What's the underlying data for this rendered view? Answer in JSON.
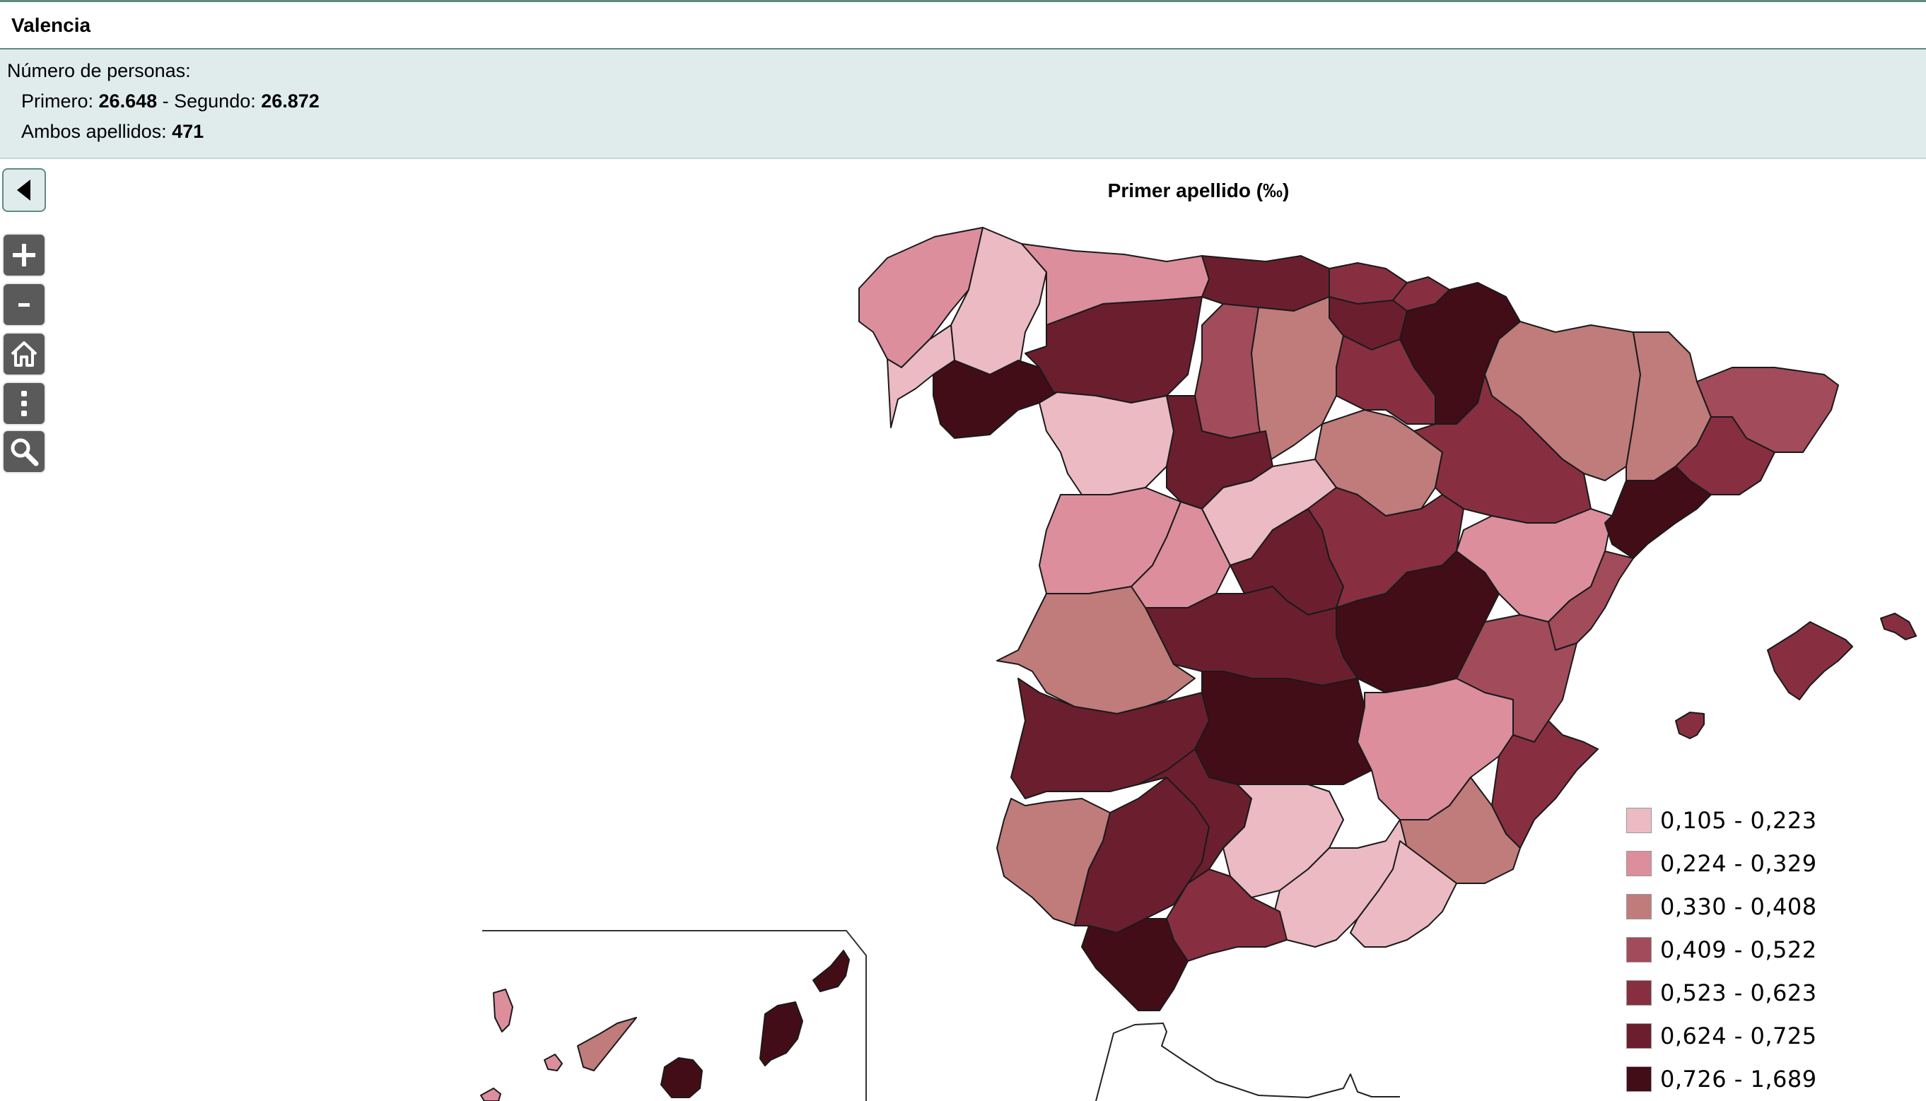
{
  "header": {
    "title": "Valencia"
  },
  "info": {
    "heading": "Número de personas:",
    "first_label": "Primero: ",
    "first_value": "26.648",
    "second_label": " - Segundo: ",
    "second_value": "26.872",
    "both_label": "Ambos apellidos: ",
    "both_value": "471"
  },
  "controls": [
    {
      "name": "zoom-in-button",
      "icon": "plus-icon"
    },
    {
      "name": "zoom-out-button",
      "icon": "minus-icon"
    },
    {
      "name": "home-button",
      "icon": "home-icon"
    },
    {
      "name": "menu-button",
      "icon": "vertical-dots-icon"
    },
    {
      "name": "search-button",
      "icon": "search-icon"
    }
  ],
  "map": {
    "title": "Primer apellido (‰)",
    "legend": [
      {
        "label": "0,105 - 0,223",
        "color": "#ecbac3"
      },
      {
        "label": "0,224 - 0,329",
        "color": "#dc8e9c"
      },
      {
        "label": "0,330 - 0,408",
        "color": "#c07b7b"
      },
      {
        "label": "0,409 - 0,522",
        "color": "#a24b5a"
      },
      {
        "label": "0,523 - 0,623",
        "color": "#872f40"
      },
      {
        "label": "0,624 - 0,725",
        "color": "#6b1f2e"
      },
      {
        "label": "0,726 - 1,689",
        "color": "#420d17"
      }
    ]
  }
}
